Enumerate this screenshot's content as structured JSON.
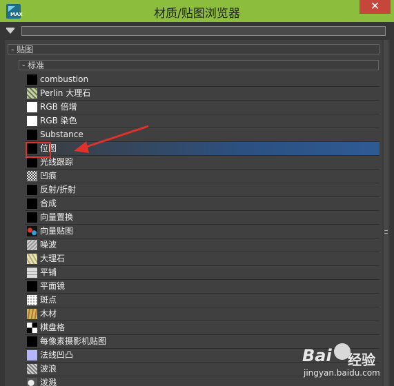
{
  "window": {
    "title": "材质/贴图浏览器",
    "close_glyph": "✕",
    "icon_text": "MAX"
  },
  "search": {
    "value": ""
  },
  "tree": {
    "group_maps": "- 贴图",
    "group_standard": "- 标准"
  },
  "items": [
    {
      "label": "combustion",
      "swatch": "black"
    },
    {
      "label": "Perlin 大理石",
      "swatch": "perlin"
    },
    {
      "label": "RGB 倍增",
      "swatch": "white"
    },
    {
      "label": "RGB 染色",
      "swatch": "white"
    },
    {
      "label": "Substance",
      "swatch": "black"
    },
    {
      "label": "位图",
      "swatch": "black",
      "selected": true
    },
    {
      "label": "光线跟踪",
      "swatch": "black"
    },
    {
      "label": "凹痕",
      "swatch": "dent"
    },
    {
      "label": "反射/折射",
      "swatch": "black"
    },
    {
      "label": "合成",
      "swatch": "black"
    },
    {
      "label": "向量置换",
      "swatch": "black"
    },
    {
      "label": "向量贴图",
      "swatch": "vecmap"
    },
    {
      "label": "噪波",
      "swatch": "noise"
    },
    {
      "label": "大理石",
      "swatch": "marble"
    },
    {
      "label": "平铺",
      "swatch": "tiles"
    },
    {
      "label": "平面镜",
      "swatch": "black"
    },
    {
      "label": "斑点",
      "swatch": "speckle"
    },
    {
      "label": "木材",
      "swatch": "wood"
    },
    {
      "label": "棋盘格",
      "swatch": "checker"
    },
    {
      "label": "每像素摄影机贴图",
      "swatch": "black"
    },
    {
      "label": "法线凹凸",
      "swatch": "normal"
    },
    {
      "label": "波浪",
      "swatch": "waves"
    },
    {
      "label": "泼溅",
      "swatch": "splat"
    }
  ],
  "watermark": {
    "logo": "Bai",
    "logo_suffix": "经验",
    "url": "jingyan.baidu.com"
  },
  "colors": {
    "titlebar": "#8cbd3c",
    "selection": "#2e5a94",
    "annotation_red": "#e0312b",
    "close": "#c7463c"
  }
}
